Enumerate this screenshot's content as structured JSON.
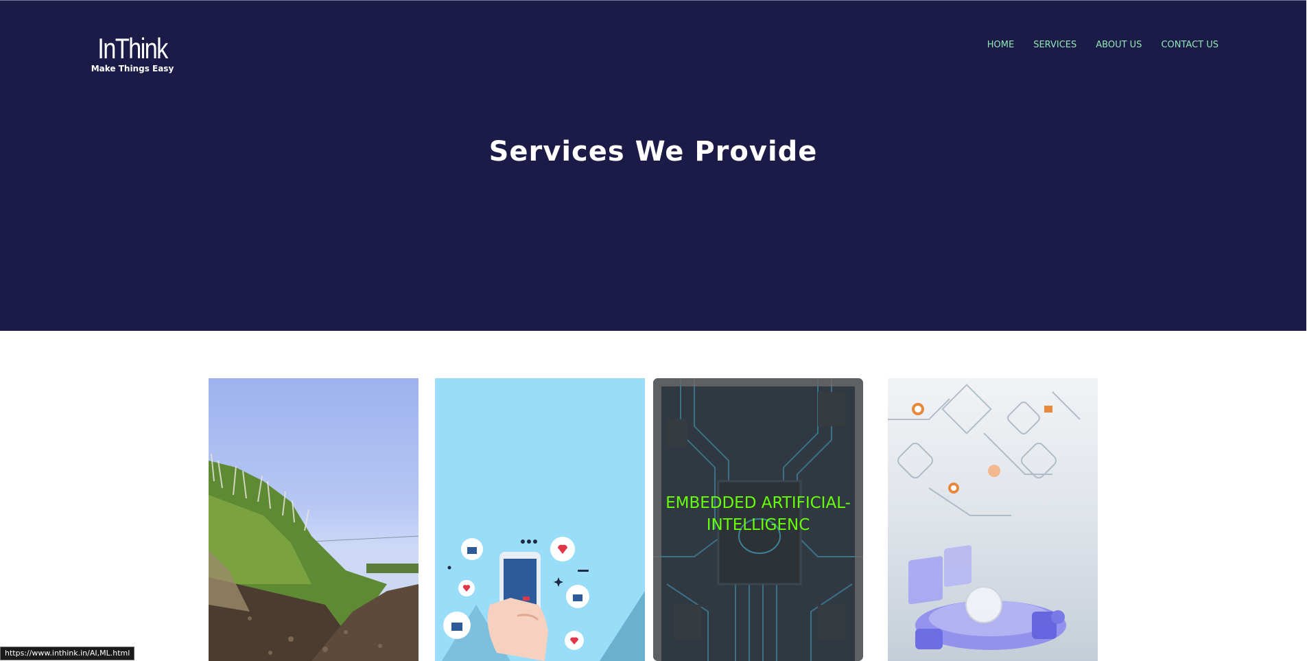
{
  "logo": {
    "name": "InThink",
    "tagline": "Make Things Easy"
  },
  "nav": {
    "items": [
      "HOME",
      "SERVICES",
      "ABOUT US",
      "CONTACT US"
    ]
  },
  "hero": {
    "title": "Services We Provide"
  },
  "cards": {
    "ai_label": "EMBEDDED ARTIFICIAL-INTELLIGENC"
  },
  "status_bar": {
    "url": "https://www.inthink.in/AI,ML.html"
  },
  "colors": {
    "hero_bg": "#1c1a47",
    "nav_link": "#8fe8b4",
    "ai_label": "#67ff08"
  }
}
